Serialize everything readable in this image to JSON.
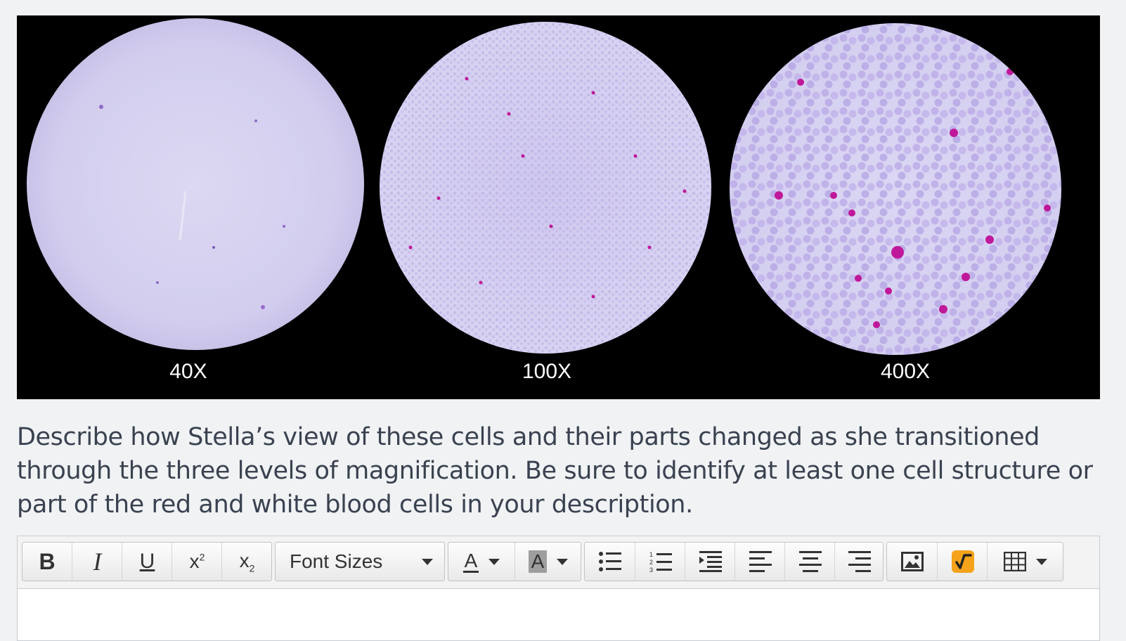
{
  "images": {
    "micrographs": [
      {
        "magnification": "40X"
      },
      {
        "magnification": "100X"
      },
      {
        "magnification": "400X"
      }
    ]
  },
  "question": {
    "text": "Describe how Stella’s view of these cells and their parts changed as she transitioned through the three levels of magnification. Be sure to identify at least one cell structure or part of the red and white blood cells in your description."
  },
  "editor": {
    "toolbar": {
      "font_sizes_label": "Font Sizes",
      "text_color_label": "A",
      "bg_color_label": "A",
      "buttons": [
        "bold",
        "italic",
        "underline",
        "superscript",
        "subscript",
        "font-sizes",
        "text-color",
        "background-color",
        "bulleted-list",
        "numbered-list",
        "indent",
        "align-left",
        "align-center",
        "align-right",
        "insert-image",
        "equation",
        "table"
      ]
    },
    "content": ""
  },
  "colors": {
    "page_bg": "#f0f2f4",
    "text": "#3a4250",
    "stain_purple": "#a06ad8",
    "nucleus_magenta": "#c0189a",
    "equation_orange": "#f5a31a"
  }
}
